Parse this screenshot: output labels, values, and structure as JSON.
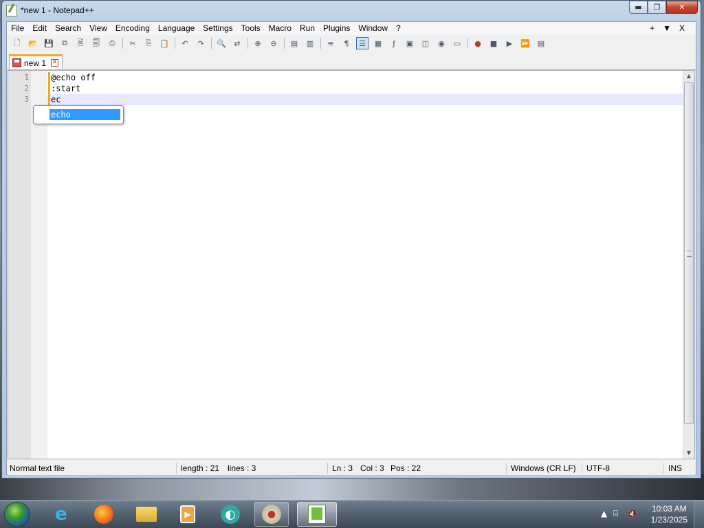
{
  "window": {
    "title": "*new 1 - Notepad++",
    "minimize_glyph": "▬",
    "maximize_glyph": "❐",
    "close_glyph": "✕"
  },
  "menu": {
    "items": [
      "File",
      "Edit",
      "Search",
      "View",
      "Encoding",
      "Language",
      "Settings",
      "Tools",
      "Macro",
      "Run",
      "Plugins",
      "Window",
      "?"
    ],
    "right_plus": "+",
    "right_arrow": "▼",
    "right_close": "X"
  },
  "toolbar": {
    "icons": [
      "new-file-icon",
      "open-file-icon",
      "save-icon",
      "save-all-icon",
      "close-icon",
      "close-all-icon",
      "print-icon",
      "cut-icon",
      "copy-icon",
      "paste-icon",
      "undo-icon",
      "redo-icon",
      "find-icon",
      "replace-icon",
      "zoom-in-icon",
      "zoom-out-icon",
      "sync-vertical-icon",
      "sync-horizontal-icon",
      "word-wrap-icon",
      "show-all-chars-icon",
      "indent-guide-icon",
      "udl-icon",
      "function-list-icon",
      "doc-map-icon",
      "folder-workspace-icon",
      "monitoring-icon",
      "record-macro-icon",
      "stop-record-icon",
      "play-macro-icon",
      "run-macro-multiple-icon",
      "save-macro-icon"
    ]
  },
  "tab": {
    "label": "new 1",
    "close_glyph": "✕"
  },
  "editor": {
    "line_numbers": [
      "1",
      "2",
      "3"
    ],
    "lines": [
      "@echo off",
      ":start",
      "ec"
    ],
    "autocomplete": {
      "items": [
        "echo"
      ]
    }
  },
  "statusbar": {
    "file_type": "Normal text file",
    "length": "length : 21",
    "lines": "lines : 3",
    "ln": "Ln : 3",
    "col": "Col : 3",
    "pos": "Pos : 22",
    "eol": "Windows (CR LF)",
    "encoding": "UTF-8",
    "mode": "INS"
  },
  "taskbar": {
    "apps": [
      "internet-explorer",
      "firefox",
      "file-explorer",
      "media-player",
      "chat-app",
      "paint",
      "notepad-plus-plus"
    ],
    "clock_time": "10:03 AM",
    "clock_date": "1/23/2025"
  }
}
